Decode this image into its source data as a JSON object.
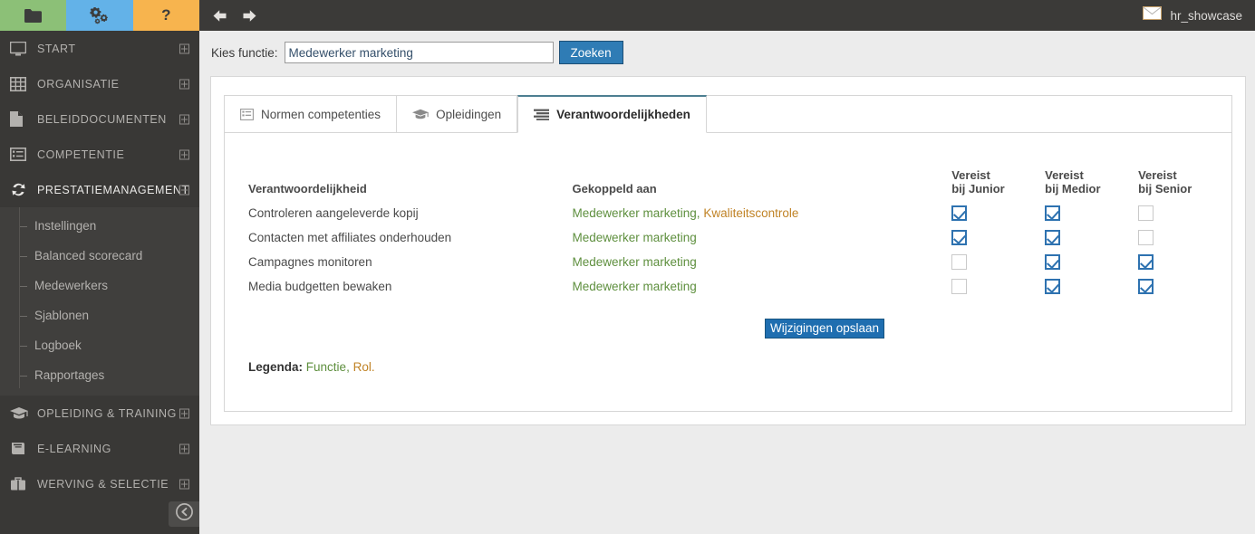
{
  "sidebar": {
    "quick_buttons": [
      {
        "name": "folder-icon",
        "color": "#8cc077",
        "label": ""
      },
      {
        "name": "settings-icon",
        "color": "#63b2e8",
        "label": ""
      },
      {
        "name": "help-icon",
        "color": "#f7b44e",
        "label": "?"
      }
    ],
    "items": [
      {
        "label": "START",
        "icon": "monitor-icon",
        "expander": "plus",
        "active": false
      },
      {
        "label": "ORGANISATIE",
        "icon": "grid-icon",
        "expander": "plus",
        "active": false
      },
      {
        "label": "BELEIDDOCUMENTEN",
        "icon": "document-icon",
        "expander": "plus",
        "active": false
      },
      {
        "label": "COMPETENTIE",
        "icon": "list-icon",
        "expander": "plus",
        "active": false
      },
      {
        "label": "PRESTATIEMANAGEMENT",
        "icon": "refresh-icon",
        "expander": "minus",
        "active": true
      }
    ],
    "submenu": [
      {
        "label": "Instellingen"
      },
      {
        "label": "Balanced scorecard"
      },
      {
        "label": "Medewerkers"
      },
      {
        "label": "Sjablonen"
      },
      {
        "label": "Logboek"
      },
      {
        "label": "Rapportages"
      }
    ],
    "items_bottom": [
      {
        "label": "OPLEIDING & TRAINING",
        "icon": "graduation-icon",
        "expander": "plus"
      },
      {
        "label": "E-LEARNING",
        "icon": "book-icon",
        "expander": "plus"
      },
      {
        "label": "WERVING & SELECTIE",
        "icon": "briefcase-icon",
        "expander": "plus"
      }
    ],
    "collapse_icon": "collapse-left-icon"
  },
  "topbar": {
    "back_icon": "arrow-left-icon",
    "forward_icon": "arrow-right-icon",
    "mail_icon": "envelope-icon",
    "username": "hr_showcase"
  },
  "search": {
    "label": "Kies functie:",
    "value": "Medewerker marketing",
    "placeholder": "",
    "button": "Zoeken"
  },
  "tabs": [
    {
      "label": "Normen competenties",
      "icon": "list-lines-icon",
      "active": false
    },
    {
      "label": "Opleidingen",
      "icon": "graduation-icon",
      "active": false
    },
    {
      "label": "Verantwoordelijkheden",
      "icon": "hamburger-bars-icon",
      "active": true
    }
  ],
  "table": {
    "headers": {
      "responsibility": "Verantwoordelijkheid",
      "linked": "Gekoppeld aan",
      "junior_l1": "Vereist",
      "junior_l2": "bij Junior",
      "medior_l1": "Vereist",
      "medior_l2": "bij Medior",
      "senior_l1": "Vereist",
      "senior_l2": "bij Senior"
    },
    "rows": [
      {
        "responsibility": "Controleren aangeleverde kopij",
        "linked_functie": "Medewerker marketing",
        "linked_sep": ", ",
        "linked_rol": "Kwaliteitscontrole",
        "junior": true,
        "medior": true,
        "senior": false
      },
      {
        "responsibility": "Contacten met affiliates onderhouden",
        "linked_functie": "Medewerker marketing",
        "linked_sep": "",
        "linked_rol": "",
        "junior": true,
        "medior": true,
        "senior": false
      },
      {
        "responsibility": "Campagnes monitoren",
        "linked_functie": "Medewerker marketing",
        "linked_sep": "",
        "linked_rol": "",
        "junior": false,
        "medior": true,
        "senior": true
      },
      {
        "responsibility": "Media budgetten bewaken",
        "linked_functie": "Medewerker marketing",
        "linked_sep": "",
        "linked_rol": "",
        "junior": false,
        "medior": true,
        "senior": true
      }
    ]
  },
  "save_button": "Wijzigingen opslaan",
  "legend": {
    "title": "Legenda:",
    "functie": "Functie",
    "separator": ", ",
    "rol": "Rol",
    "end": "."
  },
  "colors": {
    "accent_blue": "#2f7cb5",
    "functie_green": "#5e8f3e",
    "rol_orange": "#c08326",
    "tab_active": "#4d7f91",
    "sidebar_bg": "#393836"
  }
}
